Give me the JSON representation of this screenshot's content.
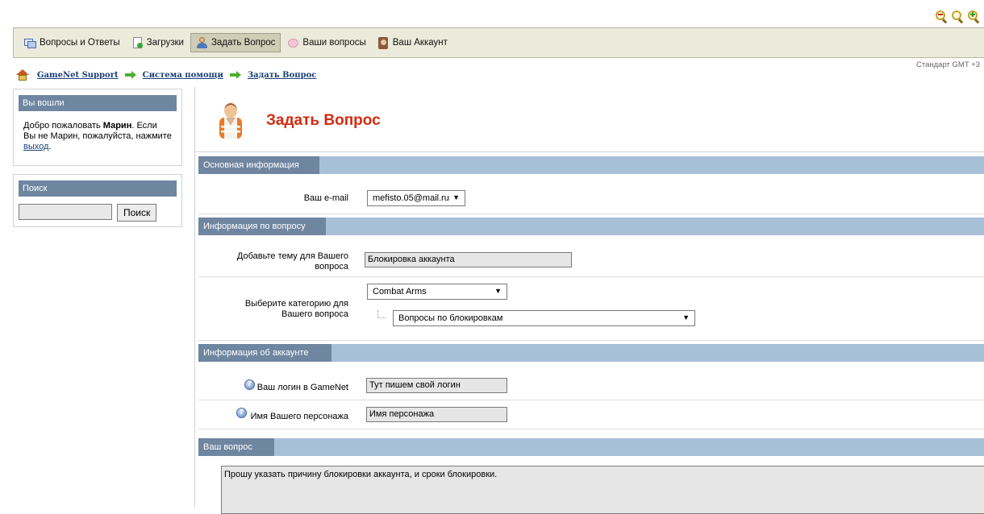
{
  "nav": {
    "tabs": [
      {
        "label": "Вопросы и Ответы",
        "icon": "qa-icon"
      },
      {
        "label": "Загрузки",
        "icon": "downloads-icon"
      },
      {
        "label": "Задать Вопрос",
        "icon": "user-icon",
        "active": true
      },
      {
        "label": "Ваши вопросы",
        "icon": "questions-icon"
      },
      {
        "label": "Ваш Аккаунт",
        "icon": "account-icon"
      }
    ]
  },
  "timezone": "Стандарт GMT +3",
  "breadcrumb": [
    "GameNet Support",
    "Система помощи",
    "Задать Вопрос"
  ],
  "sidebar": {
    "login": {
      "title": "Вы вошли",
      "greeting_pre": "Добро пожаловать ",
      "user": "Марин",
      "greeting_post": ". Если Вы не Марин, пожалуйста, нажмите ",
      "logout_link": "выход",
      "tail": "."
    },
    "search": {
      "title": "Поиск",
      "input_value": "",
      "button_label": "Поиск"
    }
  },
  "page": {
    "title": "Задать Вопрос"
  },
  "form": {
    "basic": {
      "header": "Основная информация",
      "email_label": "Ваш e-mail",
      "email_value": "mefisto.05@mail.ru"
    },
    "question_info": {
      "header": "Информация по вопросу",
      "subject_label": "Добавьте тему для Вашего вопроса",
      "subject_value": "Блокировка аккаунта",
      "category_label": "Выберите категорию для Вашего вопроса",
      "category_value": "Combat Arms",
      "subcategory_value": "Вопросы по блокировкам"
    },
    "account_info": {
      "header": "Информация об аккаунте",
      "login_label": "Ваш логин в GameNet",
      "login_value": "Тут пишем свой логин",
      "character_label": "Имя Вашего персонажа",
      "character_value": "Имя персонажа"
    },
    "question": {
      "header": "Ваш вопрос",
      "text": "Прошу указать причину блокировки аккаунта, и сроки блокировки."
    }
  },
  "colors": {
    "section_header": "#6f86a0",
    "section_band": "#a8bfd8",
    "title_red": "#d12c10",
    "link_blue": "#1a3f78"
  }
}
